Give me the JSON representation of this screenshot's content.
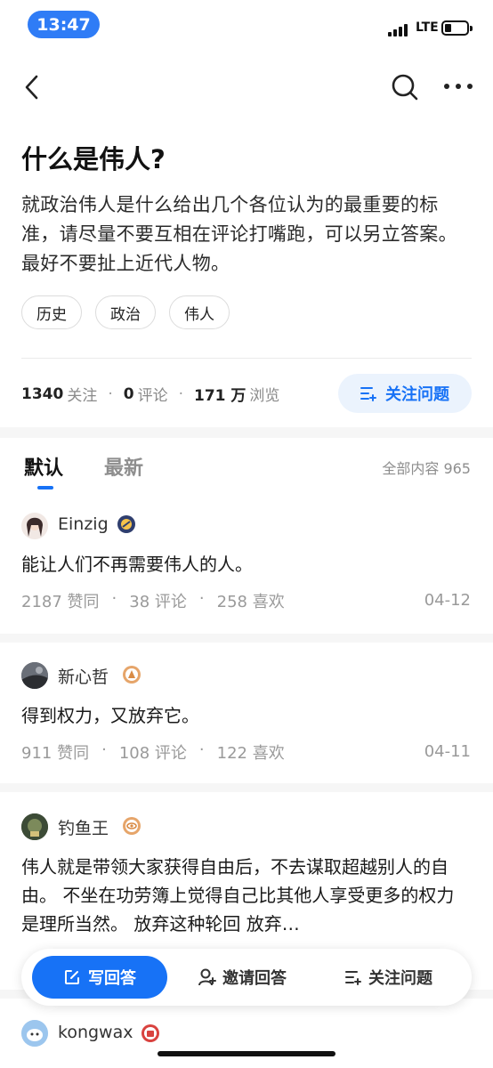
{
  "status_bar": {
    "time": "13:47",
    "network": "LTE"
  },
  "question": {
    "title": "什么是伟人?",
    "description": "就政治伟人是什么给出几个各位认为的最重要的标准，请尽量不要互相在评论打嘴跑，可以另立答案。最好不要扯上近代人物。",
    "tags": [
      "历史",
      "政治",
      "伟人"
    ],
    "followers_count": "1340",
    "followers_label": "关注",
    "comments_count": "0",
    "comments_label": "评论",
    "views_count": "171 万",
    "views_label": "浏览",
    "follow_button": "关注问题"
  },
  "tabs": {
    "default": "默认",
    "latest": "最新",
    "total": "全部内容 965"
  },
  "answers": [
    {
      "author": "Einzig",
      "text": "能让人们不再需要伟人的人。",
      "likes": "2187 赞同",
      "comments": "38 评论",
      "favs": "258 喜欢",
      "date": "04-12"
    },
    {
      "author": "新心哲",
      "text": "得到权力，又放弃它。",
      "likes": "911 赞同",
      "comments": "108 评论",
      "favs": "122 喜欢",
      "date": "04-11"
    },
    {
      "author": "钓鱼王",
      "text": "伟人就是带领大家获得自由后，不去谋取超越别人的自由。 不坐在功劳簿上觉得自己比其他人享受更多的权力是理所当然。 放弃这种轮回 放弃…",
      "likes": "",
      "comments": "",
      "favs": "",
      "date": ""
    },
    {
      "author": "kongwax",
      "text": "",
      "likes": "",
      "comments": "",
      "favs": "",
      "date": ""
    }
  ],
  "action_bar": {
    "write": "写回答",
    "invite": "邀请回答",
    "follow": "关注问题"
  },
  "colors": {
    "accent": "#1772f6",
    "status_pill": "#2f7cf6",
    "follow_bg": "#ebf3fd"
  }
}
